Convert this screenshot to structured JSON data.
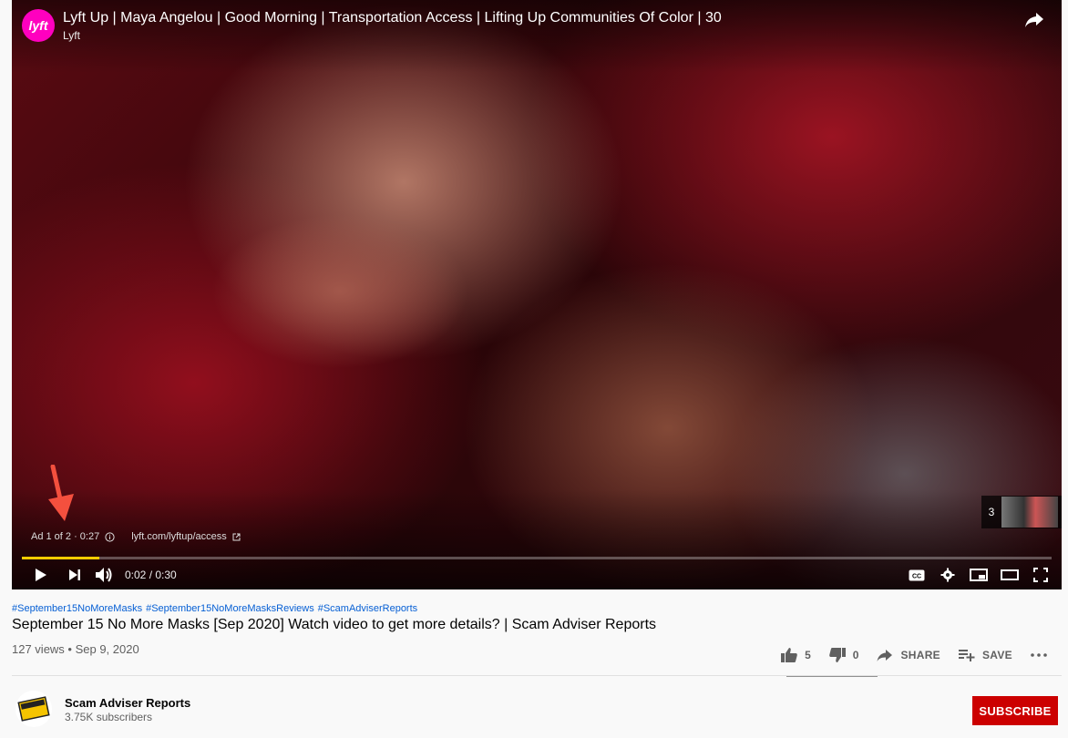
{
  "ad": {
    "title": "Lyft Up | Maya Angelou | Good Morning | Transportation Access | Lifting Up Communities Of Color | 30",
    "channel": "Lyft",
    "logo_text": "lyft",
    "info": "Ad 1 of 2 · 0:27",
    "link": "lyft.com/lyftup/access",
    "next_count": "3"
  },
  "player": {
    "time": "0:02 / 0:30",
    "progress_fraction": 0.075,
    "progress_color": "#ffcc00"
  },
  "video": {
    "hashtags": [
      "#September15NoMoreMasks",
      "#September15NoMoreMasksReviews",
      "#ScamAdviserReports"
    ],
    "title": "September 15 No More Masks [Sep 2020] Watch video to get more details? | Scam Adviser Reports",
    "views_date": "127 views • Sep 9, 2020",
    "likes": "5",
    "dislikes": "0",
    "share_label": "SHARE",
    "save_label": "SAVE"
  },
  "channel": {
    "name": "Scam Adviser Reports",
    "subscribers": "3.75K subscribers",
    "avatar_text": "WARNING SCAM",
    "subscribe_label": "SUBSCRIBE"
  },
  "colors": {
    "subscribe": "#cc0000",
    "link": "#065fd4",
    "ad_brand": "#ff00bf"
  }
}
